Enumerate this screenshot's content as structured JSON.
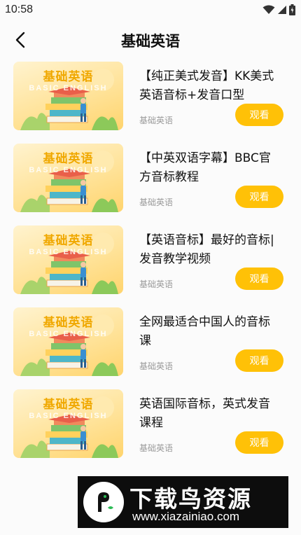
{
  "status_bar": {
    "time": "10:58",
    "icons": [
      "wifi-icon",
      "signal-icon",
      "battery-charging-icon"
    ]
  },
  "header": {
    "back_icon": "chevron-left-icon",
    "title": "基础英语"
  },
  "thumbnail": {
    "title": "基础英语",
    "subtitle": "BASIC ENGLISH"
  },
  "courses": [
    {
      "title": "【纯正美式发音】KK美式英语音标+发音口型",
      "category": "基础英语",
      "button": "观看"
    },
    {
      "title": "【中英双语字幕】BBC官方音标教程",
      "category": "基础英语",
      "button": "观看"
    },
    {
      "title": "【英语音标】最好的音标|发音教学视频",
      "category": "基础英语",
      "button": "观看"
    },
    {
      "title": "全网最适合中国人的音标课",
      "category": "基础英语",
      "button": "观看"
    },
    {
      "title": "英语国际音标，英式发音课程",
      "category": "基础英语",
      "button": "观看"
    }
  ],
  "watermark": {
    "name": "下载鸟资源",
    "url": "www.xiazainiao.com"
  },
  "colors": {
    "accent": "#ffc107",
    "thumb_title": "#f0a800",
    "category_text": "#9a9a9a"
  }
}
